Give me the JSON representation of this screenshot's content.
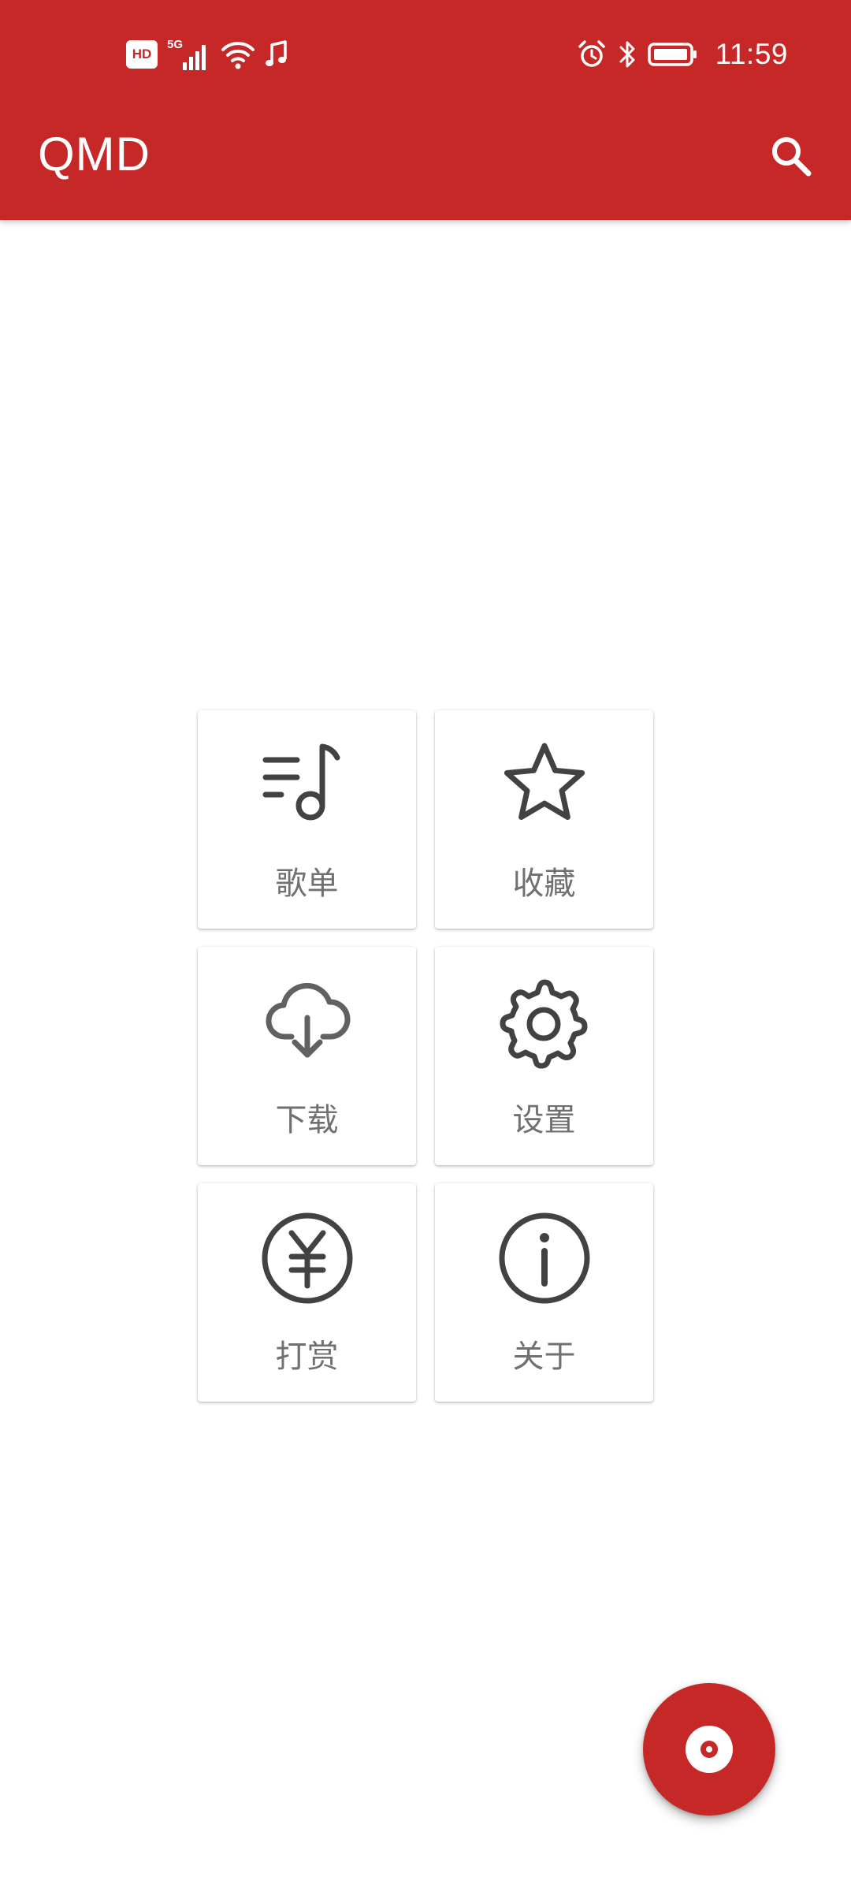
{
  "status_bar": {
    "hd_badge": "HD",
    "network": "5G",
    "time": "11:59"
  },
  "toolbar": {
    "title": "QMD",
    "search_icon": "search-icon"
  },
  "menu": {
    "items": [
      {
        "label": "歌单",
        "icon": "playlist-icon"
      },
      {
        "label": "收藏",
        "icon": "star-icon"
      },
      {
        "label": "下载",
        "icon": "cloud-download-icon"
      },
      {
        "label": "设置",
        "icon": "settings-gear-icon"
      },
      {
        "label": "打赏",
        "icon": "yen-coin-icon"
      },
      {
        "label": "关于",
        "icon": "info-icon"
      }
    ]
  },
  "fab": {
    "icon": "disc-icon"
  },
  "colors": {
    "primary": "#c62828",
    "icon": "#424242",
    "label": "#707070",
    "background": "#ffffff"
  }
}
